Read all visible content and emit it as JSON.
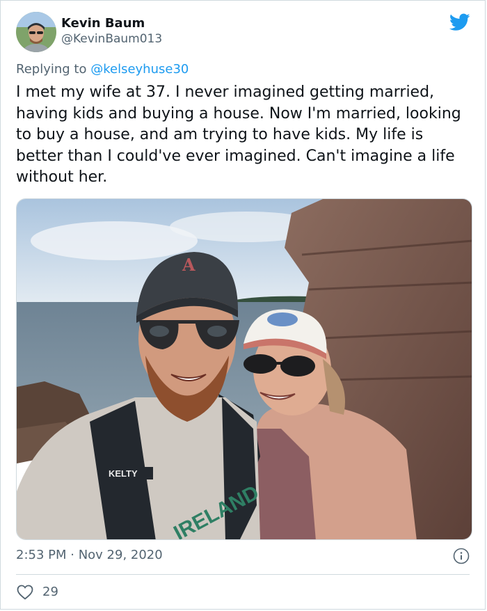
{
  "tweet": {
    "author_name": "Kevin Baum",
    "author_handle": "@KevinBaum013",
    "reply_prefix": "Replying to",
    "reply_to": "@kelseyhuse30",
    "text": "I met my wife at 37. I never imagined getting married, having kids and buying a house. Now I'm married, looking to buy a house, and am trying to have kids. My life is better than I could've ever imagined. Can't imagine a life without her.",
    "timestamp": "2:53 PM · Nov 29, 2020",
    "like_count": "29"
  },
  "photo": {
    "backpack_brand": "KELTY",
    "shirt_text": "IRELAND",
    "hat_letter": "A"
  },
  "icons": {
    "brand": "twitter-bird-icon",
    "info": "info-icon",
    "like": "heart-icon"
  },
  "colors": {
    "twitter_blue": "#1d9bf0",
    "secondary_text": "#536471",
    "primary_text": "#0f1419"
  }
}
